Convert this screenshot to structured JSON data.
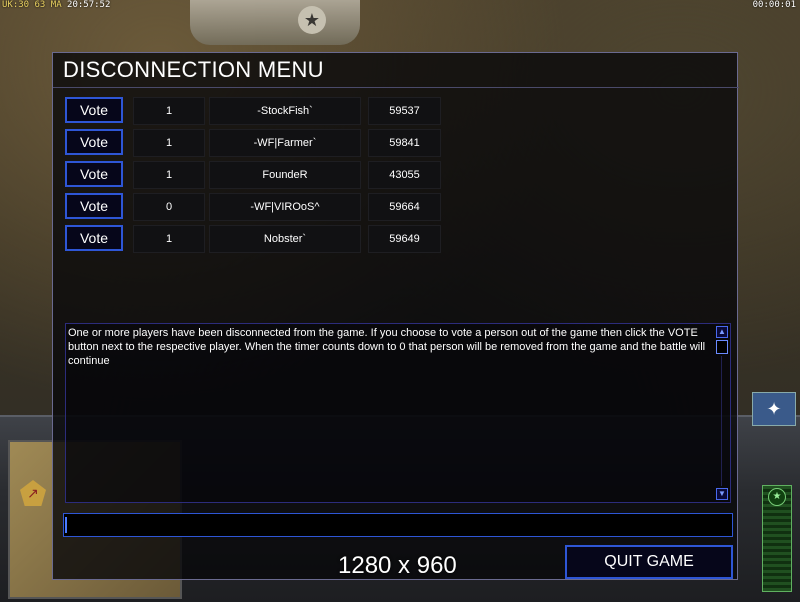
{
  "hud": {
    "top_left_a": "UK:30",
    "top_left_b": "63",
    "top_left_c": "MA",
    "top_left_time": "20:57:52",
    "top_right_time": "00:00:01"
  },
  "dialog": {
    "title": "DISCONNECTION MENU",
    "vote_label": "Vote",
    "players": [
      {
        "count": "1",
        "name": "-StockFish`",
        "ping": "59537"
      },
      {
        "count": "1",
        "name": "-WF|Farmer`",
        "ping": "59841"
      },
      {
        "count": "1",
        "name": "FoundeR",
        "ping": "43055"
      },
      {
        "count": "0",
        "name": "-WF|VIROoS^",
        "ping": "59664"
      },
      {
        "count": "1",
        "name": "Nobster`",
        "ping": "59649"
      }
    ],
    "message": "One or more players have been disconnected from the game. If you choose to vote a person out of the game then click the VOTE button next to the respective player. When the timer counts down to 0 that person will be removed from the game and the battle will continue",
    "chat_value": "",
    "quit_label": "QUIT GAME"
  },
  "overlay": {
    "resolution": "1280 x 960"
  },
  "colors": {
    "accent_border": "#2e56d6",
    "dialog_bg": "#08080a",
    "text": "#ffffff"
  },
  "icons": {
    "scroll_up": "chevron-up-icon",
    "scroll_down": "chevron-down-icon",
    "base_emblem": "star-emblem-icon",
    "radar": "radar-icon"
  }
}
